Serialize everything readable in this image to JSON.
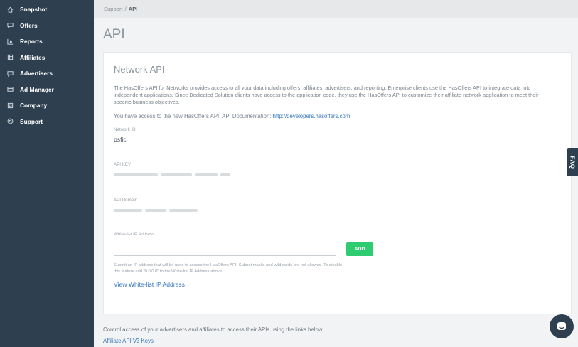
{
  "sidebar": {
    "items": [
      {
        "label": "Snapshot",
        "icon": "home-icon"
      },
      {
        "label": "Offers",
        "icon": "offers-icon"
      },
      {
        "label": "Reports",
        "icon": "reports-icon"
      },
      {
        "label": "Affiliates",
        "icon": "affiliates-icon"
      },
      {
        "label": "Advertisers",
        "icon": "advertisers-icon"
      },
      {
        "label": "Ad Manager",
        "icon": "ad-manager-icon"
      },
      {
        "label": "Company",
        "icon": "company-icon"
      },
      {
        "label": "Support",
        "icon": "support-icon"
      }
    ]
  },
  "breadcrumb": {
    "parent": "Support",
    "separator": "/",
    "current": "API"
  },
  "page": {
    "title": "API"
  },
  "network_api": {
    "heading": "Network API",
    "description": "The HasOffers API for Networks provides access to all your data including offers, affiliates, advertisers, and reporting. Enterprise clients use the HasOffers API to integrate data into independent applications. Since Dedicated Solution clients have access to the application code, they use the HasOffers API to customize their affiliate network application to meet their specific business objectives.",
    "access_text": "You have access to the new HasOffers API. API Documentation:",
    "doc_link": "http://developers.hasoffers.com",
    "network_id_label": "Network ID",
    "network_id_value": "psfic",
    "api_key_label": "API KEY",
    "api_domain_label": "API Domain",
    "whitelist_label": "White-list IP Address",
    "add_label": "ADD",
    "whitelist_hint": "Submit an IP address that will be used to access the HasOffers API. Subnet masks and wild cards are not allowed. To disable this feature add \"0.0.0.0\" to the White-list IP Address above.",
    "view_whitelist_link": "View White-list IP Address"
  },
  "control": {
    "text": "Control access of your advertisers and affiliates to access their APIs using the links below:",
    "affiliate_link": "Affiliate API V3 Keys"
  },
  "faq": {
    "label": "FAQ"
  },
  "colors": {
    "sidebar": "#2e3f50",
    "accent": "#2ecc71",
    "link": "#3475bd"
  }
}
